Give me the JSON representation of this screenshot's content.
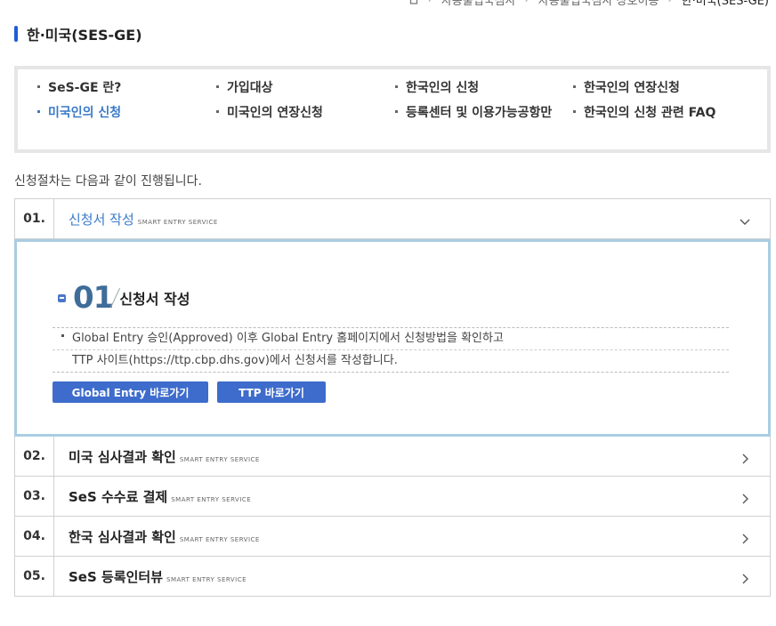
{
  "breadcrumb": {
    "items": [
      "자동출입국심사",
      "자동출입국심사 상호이용",
      "한·미국(SES-GE)"
    ]
  },
  "page_title": "한·미국(SES-GE)",
  "menu": {
    "items": [
      {
        "label": "SeS-GE 란?",
        "active": false
      },
      {
        "label": "가입대상",
        "active": false
      },
      {
        "label": "한국인의 신청",
        "active": false
      },
      {
        "label": "한국인의 연장신청",
        "active": false
      },
      {
        "label": "미국인의 신청",
        "active": true
      },
      {
        "label": "미국인의 연장신청",
        "active": false
      },
      {
        "label": "등록센터 및 이용가능공항만",
        "active": false
      },
      {
        "label": "한국인의 신청 관련 FAQ",
        "active": false
      }
    ]
  },
  "intro_text": "신청절차는 다음과 같이 진행됩니다.",
  "steps": [
    {
      "num": "01.",
      "label": "신청서 작성",
      "sub": "SMART ENTRY SERVICE",
      "open": true
    },
    {
      "num": "02.",
      "label": "미국 심사결과 확인",
      "sub": "SMART ENTRY SERVICE",
      "open": false
    },
    {
      "num": "03.",
      "label": "SeS 수수료 결제",
      "sub": "SMART ENTRY SERVICE",
      "open": false
    },
    {
      "num": "04.",
      "label": "한국 심사결과 확인",
      "sub": "SMART ENTRY SERVICE",
      "open": false
    },
    {
      "num": "05.",
      "label": "SeS 등록인터뷰",
      "sub": "SMART ENTRY SERVICE",
      "open": false
    }
  ],
  "panel": {
    "number": "01",
    "title": "신청서 작성",
    "line1": "Global Entry 승인(Approved) 이후 Global Entry 홈페이지에서 신청방법을 확인하고",
    "line2": "TTP 사이트(https://ttp.cbp.dhs.gov)에서 신청서를 작성합니다.",
    "button1": "Global Entry 바로가기",
    "button2": "TTP 바로가기"
  },
  "colors": {
    "accent": "#3a7ac7",
    "button": "#3e6ccc",
    "panel_border": "#a9cde2"
  }
}
